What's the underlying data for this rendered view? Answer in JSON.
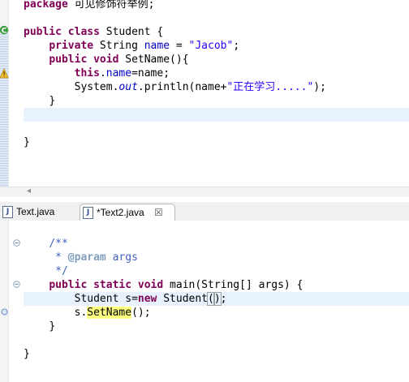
{
  "top_editor": {
    "lines": [
      {
        "type": "package",
        "keyword": "package",
        "rest": " 可见修饰符举例;"
      },
      {
        "type": "blank"
      },
      {
        "type": "class",
        "kw1": "public",
        "kw2": "class",
        "name": " Student {"
      },
      {
        "type": "field",
        "kw": "private",
        "type_name": " String ",
        "field": "name",
        "eq": " = ",
        "value": "\"Jacob\"",
        "semi": ";"
      },
      {
        "type": "method",
        "kw1": "public",
        "kw2": "void",
        "sig": " SetName(){"
      },
      {
        "type": "assign",
        "kw": "this",
        "dot": ".",
        "field": "name",
        "eq": "=",
        "rhs": "name;"
      },
      {
        "type": "println",
        "pre": "System.",
        "out": "out",
        "mid": ".println(name+",
        "str": "\"正在学习.....\"",
        "end": ");"
      },
      {
        "type": "close",
        "text": "}"
      },
      {
        "type": "blank"
      },
      {
        "type": "blank"
      },
      {
        "type": "close",
        "text": "}"
      }
    ]
  },
  "tabs": [
    {
      "label": "Text.java",
      "icon": "J"
    },
    {
      "label": "*Text2.java",
      "icon": "J",
      "close": "☒"
    }
  ],
  "bottom_editor": {
    "lines": [
      {
        "type": "comment",
        "text": "/**"
      },
      {
        "type": "comment_param",
        "star": " * ",
        "tag": "@param",
        "arg": " args"
      },
      {
        "type": "comment",
        "text": " */"
      },
      {
        "type": "main",
        "kw1": "public",
        "kw2": "static",
        "kw3": "void",
        "sig": " main(String[] args) {"
      },
      {
        "type": "newobj",
        "pre": "Student s=",
        "kw": "new",
        "post": " Student",
        "open": "(",
        "close": ")",
        "semi": ";"
      },
      {
        "type": "call",
        "pre": "s.",
        "method": "SetName",
        "post": "();"
      },
      {
        "type": "close",
        "text": "}"
      },
      {
        "type": "blank"
      },
      {
        "type": "close",
        "text": "}"
      }
    ]
  },
  "colors": {
    "keyword": "#7f0055",
    "string": "#2a00ff",
    "field": "#0000c0",
    "comment": "#3f5fbf",
    "current_line": "#e8f2fe",
    "occurrence_highlight": "#ffff80"
  }
}
